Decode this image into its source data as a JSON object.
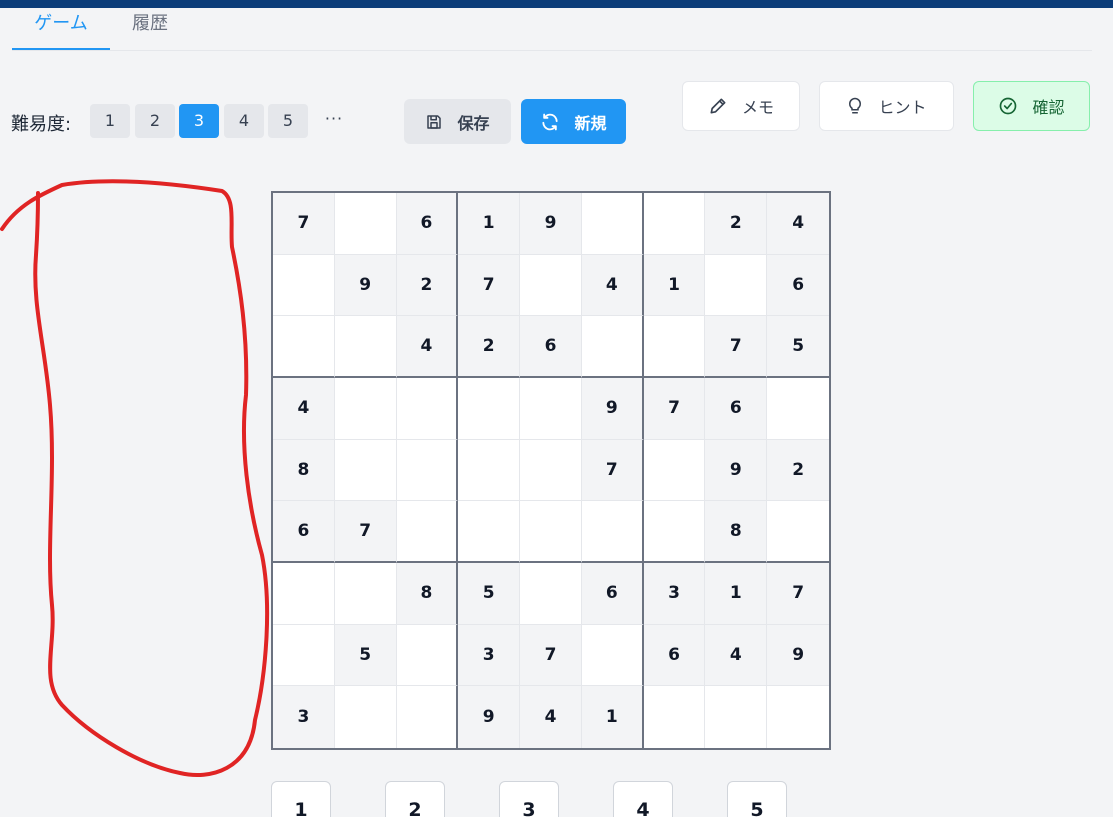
{
  "tabs": [
    {
      "label": "ゲーム",
      "active": true
    },
    {
      "label": "履歴",
      "active": false
    }
  ],
  "difficulty": {
    "label": "難易度:",
    "levels": [
      "1",
      "2",
      "3",
      "4",
      "5"
    ],
    "selected": "3",
    "more": "···"
  },
  "toolbar": {
    "save_label": "保存",
    "new_label": "新規",
    "memo_label": "メモ",
    "hint_label": "ヒント",
    "check_label": "確認"
  },
  "board": [
    [
      "7",
      "",
      "6",
      "1",
      "9",
      "",
      "",
      "2",
      "4"
    ],
    [
      "",
      "9",
      "2",
      "7",
      "",
      "4",
      "1",
      "",
      "6"
    ],
    [
      "",
      "",
      "4",
      "2",
      "6",
      "",
      "",
      "7",
      "5"
    ],
    [
      "4",
      "",
      "",
      "",
      "",
      "9",
      "7",
      "6",
      ""
    ],
    [
      "8",
      "",
      "",
      "",
      "",
      "7",
      "",
      "9",
      "2"
    ],
    [
      "6",
      "7",
      "",
      "",
      "",
      "",
      "",
      "8",
      ""
    ],
    [
      "",
      "",
      "8",
      "5",
      "",
      "6",
      "3",
      "1",
      "7"
    ],
    [
      "",
      "5",
      "",
      "3",
      "7",
      "",
      "6",
      "4",
      "9"
    ],
    [
      "3",
      "",
      "",
      "9",
      "4",
      "1",
      "",
      "",
      ""
    ]
  ],
  "numpad": [
    "1",
    "2",
    "3",
    "4",
    "5"
  ],
  "colors": {
    "accent": "#2196f3",
    "header": "#0b3d79",
    "given_cell": "#f3f4f6",
    "annotation": "#e02424",
    "check_bg": "#dcfce7"
  }
}
